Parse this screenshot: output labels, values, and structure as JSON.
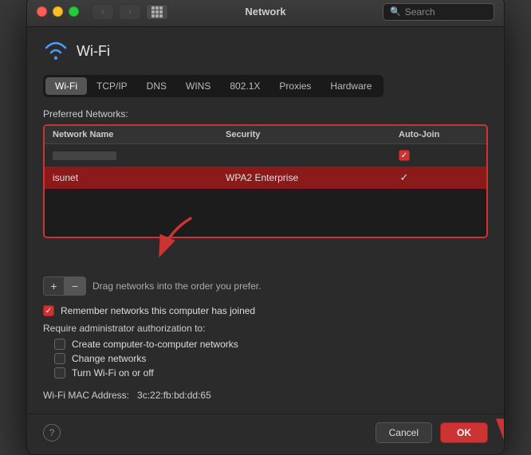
{
  "window": {
    "title": "Network",
    "search_placeholder": "Search"
  },
  "traffic_lights": {
    "close": "close",
    "minimize": "minimize",
    "maximize": "maximize"
  },
  "nav": {
    "back_label": "‹",
    "forward_label": "›"
  },
  "wifi": {
    "name": "Wi-Fi"
  },
  "tabs": [
    {
      "label": "Wi-Fi",
      "active": true
    },
    {
      "label": "TCP/IP",
      "active": false
    },
    {
      "label": "DNS",
      "active": false
    },
    {
      "label": "WINS",
      "active": false
    },
    {
      "label": "802.1X",
      "active": false
    },
    {
      "label": "Proxies",
      "active": false
    },
    {
      "label": "Hardware",
      "active": false
    }
  ],
  "preferred_networks": {
    "label": "Preferred Networks:",
    "columns": [
      "Network Name",
      "Security",
      "Auto-Join"
    ],
    "rows": [
      {
        "name": "",
        "security": "",
        "auto_join": "checkbox_red"
      },
      {
        "name": "isunet",
        "security": "WPA2 Enterprise",
        "auto_join": "checkmark"
      }
    ]
  },
  "controls": {
    "add_label": "+",
    "remove_label": "−",
    "drag_hint": "Drag networks into the order you prefer."
  },
  "remember": {
    "label": "Remember networks this computer has joined",
    "checked": true
  },
  "require_admin": {
    "label": "Require administrator authorization to:",
    "options": [
      {
        "label": "Create computer-to-computer networks",
        "checked": false
      },
      {
        "label": "Change networks",
        "checked": false
      },
      {
        "label": "Turn Wi-Fi on or off",
        "checked": false
      }
    ]
  },
  "mac_address": {
    "label": "Wi-Fi MAC Address:",
    "value": "3c:22:fb:bd:dd:65"
  },
  "footer": {
    "cancel_label": "Cancel",
    "ok_label": "OK"
  }
}
